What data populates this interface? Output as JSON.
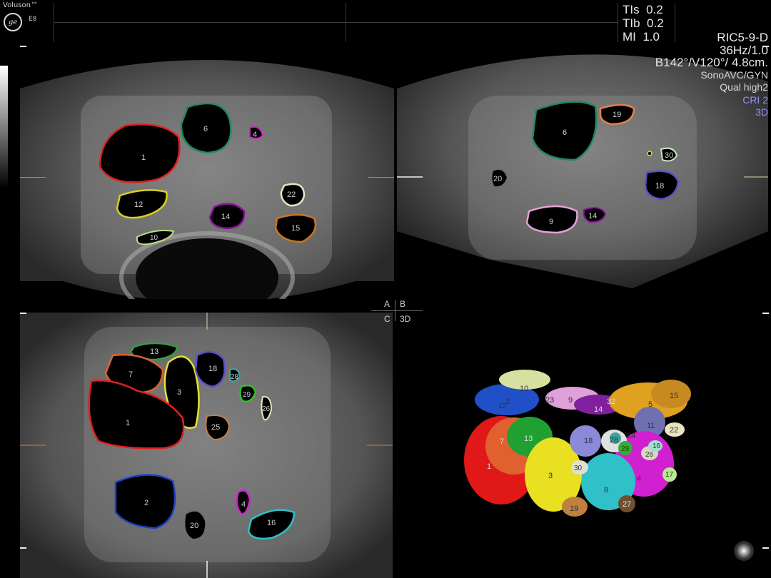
{
  "header": {
    "brand": "Voluson™",
    "model": "E8",
    "logo": "ge",
    "indices": [
      {
        "name": "TIs",
        "value": "0.2"
      },
      {
        "name": "TIb",
        "value": "0.2"
      },
      {
        "name": "MI",
        "value": "1.0"
      }
    ]
  },
  "params": {
    "probe": "RIC5-9-D",
    "frame": "36Hz/1.0",
    "geometry": "B142°/V120°/ 4.8cm.",
    "mode": "SonoAVC/GYN",
    "quality": "Qual high2",
    "cri": "CRI 2",
    "view": "3D"
  },
  "quadrant_labels": {
    "a": "A",
    "b": "B",
    "c": "C",
    "d": "3D"
  },
  "colors": {
    "label_white": "#ffffff",
    "cri": "#8f8fff",
    "view3d": "#8f8fff",
    "marker": "#e67a2c"
  },
  "panel_a": {
    "follicles": [
      {
        "n": "1",
        "color": "#e02020"
      },
      {
        "n": "6",
        "color": "#1e8a5a"
      },
      {
        "n": "4",
        "color": "#d020d0"
      },
      {
        "n": "12",
        "color": "#d8d020"
      },
      {
        "n": "14",
        "color": "#9010a0"
      },
      {
        "n": "22",
        "color": "#e8e4c0"
      },
      {
        "n": "15",
        "color": "#c87820"
      },
      {
        "n": "10",
        "color": "#b8e080"
      }
    ]
  },
  "panel_b": {
    "follicles": [
      {
        "n": "6",
        "color": "#1e8a5a"
      },
      {
        "n": "19",
        "color": "#e8804a"
      },
      {
        "n": "30",
        "color": "#c8e8c0"
      },
      {
        "n": "20",
        "color": "#707070"
      },
      {
        "n": "18",
        "color": "#5a50c8"
      },
      {
        "n": "9",
        "color": "#e8a0d8"
      },
      {
        "n": "14",
        "color": "#9010a0"
      }
    ]
  },
  "panel_c": {
    "follicles": [
      {
        "n": "13",
        "color": "#30a040"
      },
      {
        "n": "7",
        "color": "#e06030"
      },
      {
        "n": "3",
        "color": "#e8e030"
      },
      {
        "n": "18",
        "color": "#5a50c8"
      },
      {
        "n": "28",
        "color": "#30b0b0"
      },
      {
        "n": "29",
        "color": "#30c030"
      },
      {
        "n": "26",
        "color": "#e8e4c0"
      },
      {
        "n": "1",
        "color": "#e02020"
      },
      {
        "n": "25",
        "color": "#c08050"
      },
      {
        "n": "2",
        "color": "#2040c0"
      },
      {
        "n": "4",
        "color": "#d020d0"
      },
      {
        "n": "20",
        "color": "#707070"
      },
      {
        "n": "16",
        "color": "#30c0c8"
      }
    ]
  },
  "panel_3d": {
    "labels": [
      "10",
      "2",
      "12",
      "23",
      "9",
      "32",
      "14",
      "5",
      "15",
      "11",
      "22",
      "13",
      "7",
      "18",
      "28",
      "24",
      "29",
      "16",
      "26",
      "1",
      "30",
      "3",
      "8",
      "4",
      "17",
      "19",
      "27"
    ]
  }
}
